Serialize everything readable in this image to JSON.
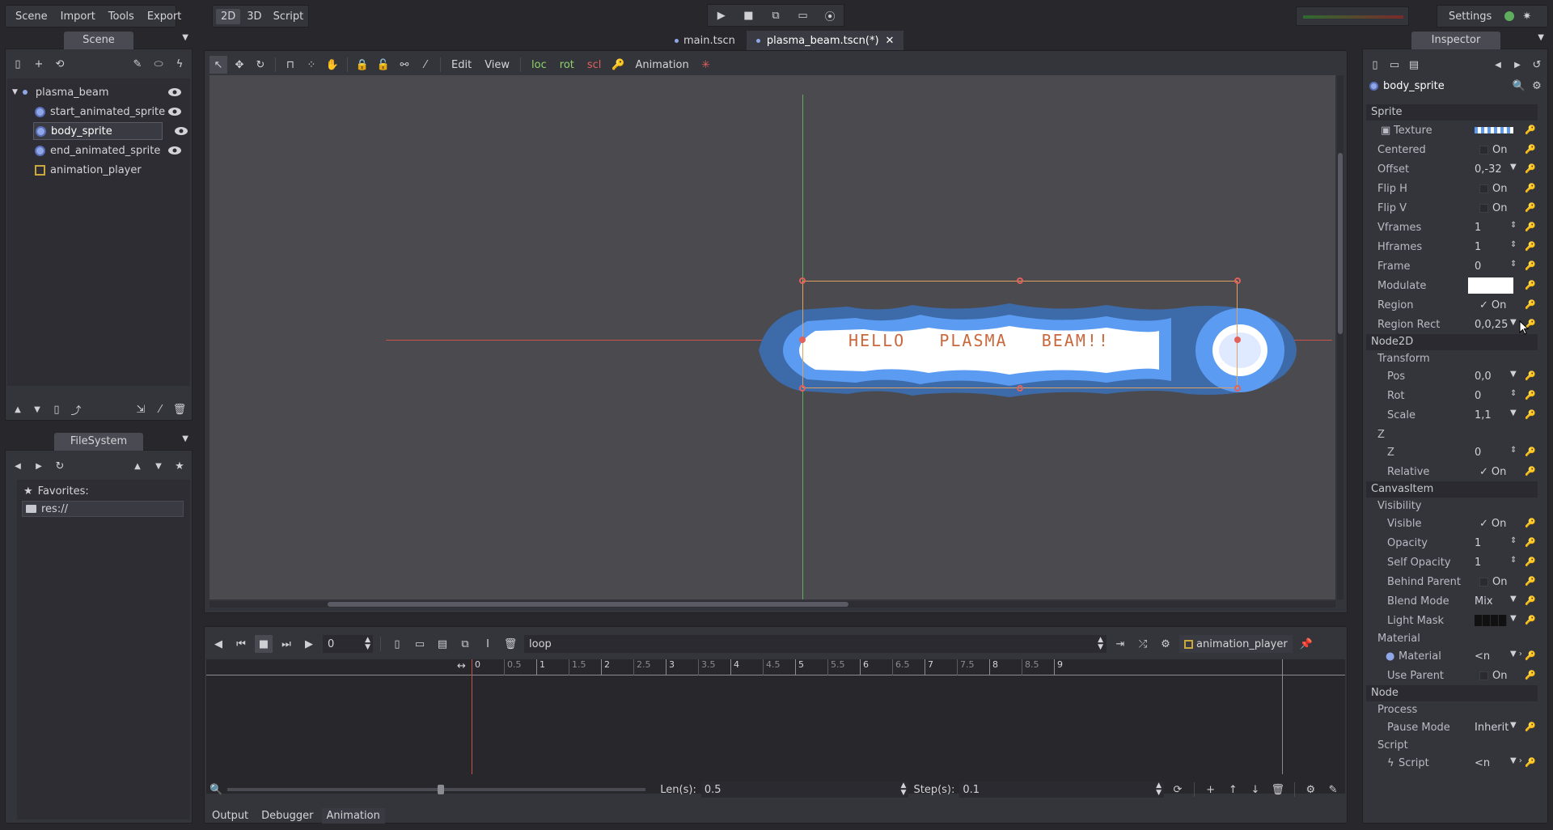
{
  "menubar": {
    "items": [
      "Scene",
      "Import",
      "Tools",
      "Export"
    ],
    "modes": [
      "2D",
      "3D",
      "Script"
    ],
    "settings_label": "Settings"
  },
  "scene_tabs": [
    "main.tscn",
    "plasma_beam.tscn(*)"
  ],
  "scene_dock": {
    "title": "Scene",
    "nodes": [
      {
        "name": "plasma_beam",
        "type": "root"
      },
      {
        "name": "start_animated_sprite",
        "type": "sprite"
      },
      {
        "name": "body_sprite",
        "type": "sprite",
        "selected": true
      },
      {
        "name": "end_animated_sprite",
        "type": "sprite"
      },
      {
        "name": "animation_player",
        "type": "anim"
      }
    ]
  },
  "filesystem_dock": {
    "title": "FileSystem",
    "favorites_label": "Favorites:",
    "root_path": "res://"
  },
  "viewport_toolbar": {
    "edit_label": "Edit",
    "view_label": "View",
    "loc_label": "loc",
    "rot_label": "rot",
    "scl_label": "scl",
    "animation_label": "Animation"
  },
  "sprite_text": "HELLO   PLASMA   BEAM!!",
  "animation_panel": {
    "time_value": "0",
    "animation_name": "loop",
    "player_name": "animation_player",
    "ruler_ticks": [
      "0",
      "0.5",
      "1",
      "1.5",
      "2",
      "2.5",
      "3",
      "3.5",
      "4",
      "4.5",
      "5",
      "5.5",
      "6",
      "6.5",
      "7",
      "7.5",
      "8",
      "8.5",
      "9"
    ],
    "len_label": "Len(s):",
    "len_value": "0.5",
    "step_label": "Step(s):",
    "step_value": "0.1"
  },
  "bottom_tabs": [
    "Output",
    "Debugger",
    "Animation"
  ],
  "inspector": {
    "title": "Inspector",
    "node_name": "body_sprite",
    "sections": {
      "sprite": "Sprite",
      "node2d": "Node2D",
      "transform": "Transform",
      "z": "Z",
      "canvasitem": "CanvasItem",
      "visibility": "Visibility",
      "material_group": "Material",
      "node": "Node",
      "process": "Process",
      "script_group": "Script"
    },
    "props": {
      "texture": "Texture",
      "centered": "Centered",
      "offset": "Offset",
      "offset_val": "0,-32",
      "fliph": "Flip H",
      "flipv": "Flip V",
      "vframes": "Vframes",
      "vframes_val": "1",
      "hframes": "Hframes",
      "hframes_val": "1",
      "frame": "Frame",
      "frame_val": "0",
      "modulate": "Modulate",
      "region": "Region",
      "region_rect": "Region Rect",
      "region_rect_val": "0,0,25",
      "pos": "Pos",
      "pos_val": "0,0",
      "rot": "Rot",
      "rot_val": "0",
      "scale": "Scale",
      "scale_val": "1,1",
      "zval_label": "Z",
      "zval": "0",
      "relative": "Relative",
      "visible": "Visible",
      "opacity": "Opacity",
      "opacity_val": "1",
      "self_opacity": "Self Opacity",
      "self_opacity_val": "1",
      "behind_parent": "Behind Parent",
      "blend_mode": "Blend Mode",
      "blend_mode_val": "Mix",
      "light_mask": "Light Mask",
      "material": "Material",
      "material_val": "<n",
      "use_parent": "Use Parent",
      "pause_mode": "Pause Mode",
      "pause_mode_val": "Inherit",
      "script": "Script",
      "script_val": "<n"
    },
    "on_label": "On"
  },
  "colors": {
    "accent": "#6c8fd9",
    "loc": "#8ed36b",
    "rot": "#8ed36b",
    "scl": "#e0625b",
    "beam_outer": "#3d6aa8",
    "beam_mid": "#5b9cf2",
    "beam_core": "#ffffff",
    "beam_text": "#c9683c"
  }
}
